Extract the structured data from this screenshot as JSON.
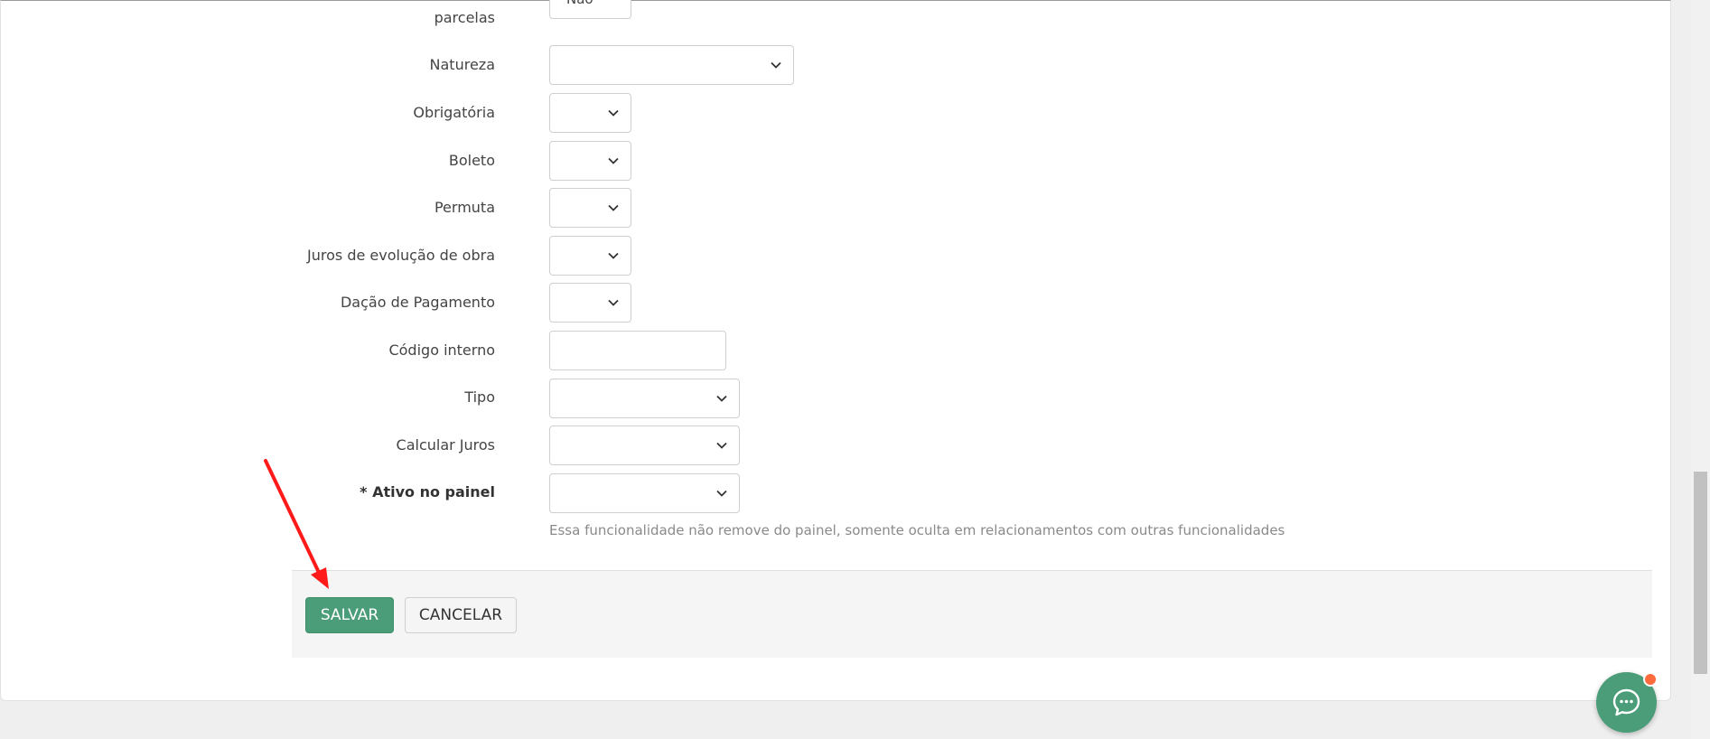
{
  "form": {
    "fields": [
      {
        "id": "parcelas",
        "label": "parcelas",
        "type": "select",
        "value": "Não"
      },
      {
        "id": "natureza",
        "label": "Natureza",
        "type": "select",
        "value": ""
      },
      {
        "id": "obrigatoria",
        "label": "Obrigatória",
        "type": "select",
        "value": ""
      },
      {
        "id": "boleto",
        "label": "Boleto",
        "type": "select",
        "value": ""
      },
      {
        "id": "permuta",
        "label": "Permuta",
        "type": "select",
        "value": ""
      },
      {
        "id": "juros-evolucao",
        "label": "Juros de evolução de obra",
        "type": "select",
        "value": ""
      },
      {
        "id": "dacao-pagamento",
        "label": "Dação de Pagamento",
        "type": "select",
        "value": ""
      },
      {
        "id": "codigo-interno",
        "label": "Código interno",
        "type": "text",
        "value": ""
      },
      {
        "id": "tipo",
        "label": "Tipo",
        "type": "select",
        "value": ""
      },
      {
        "id": "calcular-juros",
        "label": "Calcular Juros",
        "type": "select",
        "value": ""
      },
      {
        "id": "ativo-painel",
        "label": "* Ativo no painel",
        "type": "select",
        "value": "",
        "required": true
      }
    ],
    "help_text": "Essa funcionalidade não remove do painel, somente oculta em relacionamentos com outras funcionalidades"
  },
  "actions": {
    "save_label": "SALVAR",
    "cancel_label": "CANCELAR"
  },
  "colors": {
    "primary": "#4a9d78",
    "annotation_arrow": "#ff0000",
    "notification_dot": "#ff6a3d"
  },
  "icons": {
    "select_chevron": "chevron-down-icon",
    "chat": "chat-bubble-icon"
  }
}
